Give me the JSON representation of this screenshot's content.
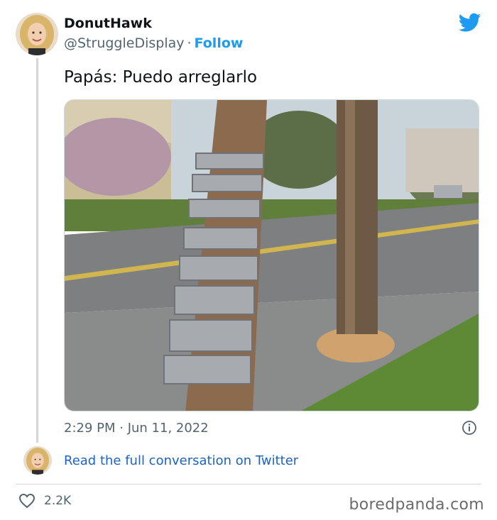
{
  "tweet": {
    "author_name": "DonutHawk",
    "author_handle": "@StruggleDisplay",
    "separator": "·",
    "follow_label": "Follow",
    "text": "Papás: Puedo arreglarlo",
    "timestamp": "2:29 PM · Jun 11, 2022",
    "read_more_label": "Read the full conversation on Twitter",
    "likes": "2.2K",
    "brand_color": "#1d9bf0"
  },
  "footer": {
    "site_logo": "boredpanda.com"
  },
  "icons": {
    "platform": "twitter-bird-icon",
    "info": "info-icon",
    "like": "heart-icon"
  }
}
